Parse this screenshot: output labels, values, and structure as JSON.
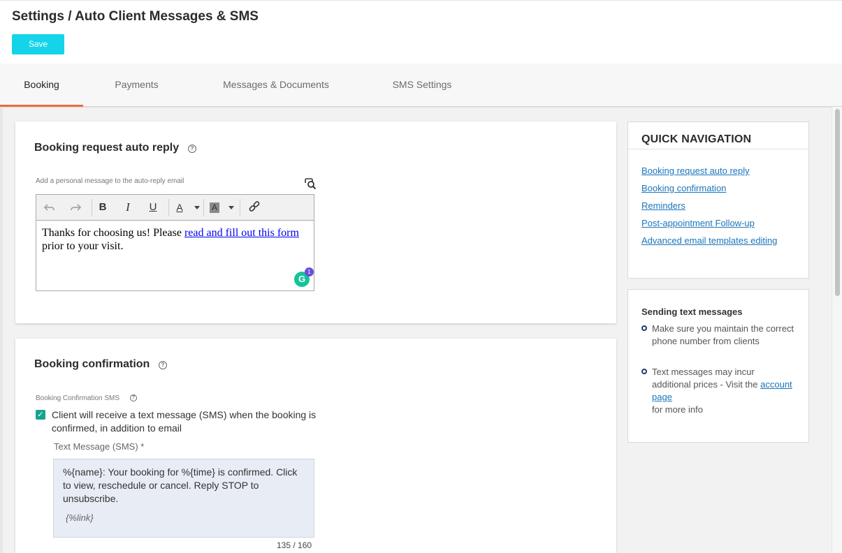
{
  "header": {
    "title": "Settings / Auto Client Messages & SMS",
    "save_label": "Save"
  },
  "tabs": [
    {
      "label": "Booking",
      "active": true
    },
    {
      "label": "Payments",
      "active": false
    },
    {
      "label": "Messages & Documents",
      "active": false
    },
    {
      "label": "SMS Settings",
      "active": false
    }
  ],
  "auto_reply": {
    "title": "Booking request auto reply",
    "help_icon": "help-circle-icon",
    "field_label": "Add a personal message to the auto-reply email",
    "preview_icon": "preview-search-icon",
    "toolbar": {
      "undo_icon": "undo-icon",
      "redo_icon": "redo-icon",
      "bold": "B",
      "italic": "I",
      "underline": "U",
      "text_color": "A",
      "highlight": "A",
      "link_icon": "link-icon"
    },
    "body_text_before": "Thanks for choosing us! Please ",
    "body_link": "read and fill out this form",
    "body_text_after": " prior to your visit.",
    "grammarly_label": "G",
    "grammarly_count": "1"
  },
  "booking_confirmation": {
    "title": "Booking confirmation",
    "help_icon": "help-circle-icon",
    "sms_label": "Booking Confirmation SMS",
    "checkbox_checked": true,
    "checkbox_label": "Client will receive a text message (SMS) when the booking is confirmed, in addition to email",
    "text_message_label": "Text Message (SMS) *",
    "sms_body": "%{name}: Your booking for %{time} is confirmed. Click to view, reschedule or cancel. Reply STOP to unsubscribe.",
    "sms_link_token": "{%link}",
    "char_count": "135 / 160"
  },
  "quick_navigation": {
    "title": "QUICK NAVIGATION",
    "links": [
      "Booking request auto reply",
      "Booking confirmation",
      "Reminders",
      "Post-appointment Follow-up",
      "Advanced email templates editing"
    ]
  },
  "sms_tips": {
    "title": "Sending text messages",
    "item1": "Make sure you maintain the correct phone number from clients",
    "item2_before": "Text messages may incur additional prices - Visit the ",
    "item2_link": "account page",
    "item2_after": " for more info"
  },
  "colors": {
    "accent": "#14d4ea",
    "tab_underline": "#ea6d3a",
    "checkbox": "#17a392",
    "link": "#1b75bb"
  }
}
